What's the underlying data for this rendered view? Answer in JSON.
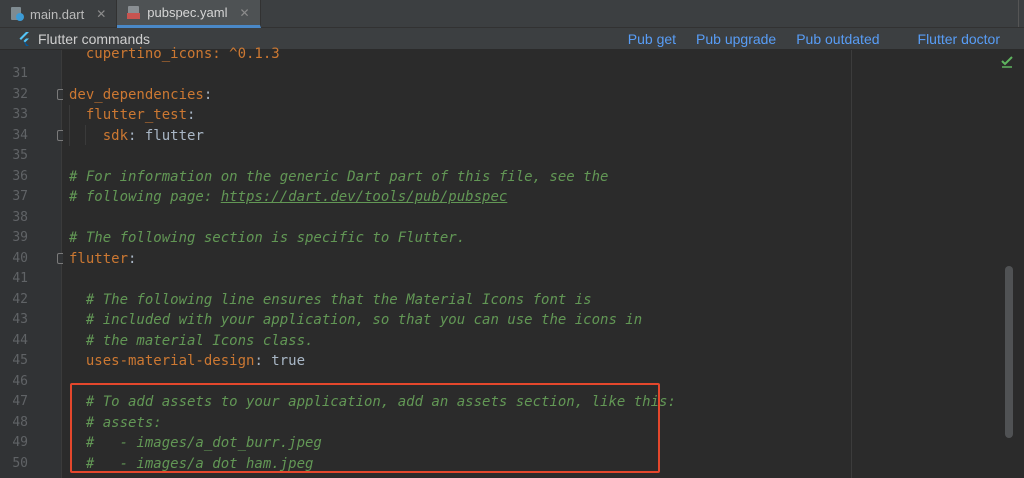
{
  "tabs": [
    {
      "label": "main.dart",
      "icon": "dart-file-icon",
      "active": false
    },
    {
      "label": "pubspec.yaml",
      "icon": "yaml-file-icon",
      "active": true
    }
  ],
  "flutter_bar": {
    "title": "Flutter commands",
    "actions": [
      "Pub get",
      "Pub upgrade",
      "Pub outdated",
      "Flutter doctor"
    ]
  },
  "editor": {
    "partial_top_line": "cupertino_icons: ^0.1.3",
    "line_numbers": [
      "31",
      "32",
      "33",
      "34",
      "35",
      "36",
      "37",
      "38",
      "39",
      "40",
      "41",
      "42",
      "43",
      "44",
      "45",
      "46",
      "47",
      "48",
      "49",
      "50"
    ],
    "line32": {
      "key": "dev_dependencies",
      "colon": ":"
    },
    "line33": {
      "key": "flutter_test",
      "colon": ":"
    },
    "line34": {
      "key": "sdk",
      "colon": ": ",
      "value": "flutter"
    },
    "line36": "# For information on the generic Dart part of this file, see the",
    "line37_prefix": "# following page: ",
    "line37_link": "https://dart.dev/tools/pub/pubspec",
    "line39": "# The following section is specific to Flutter.",
    "line40": {
      "key": "flutter",
      "colon": ":"
    },
    "line42": "# The following line ensures that the Material Icons font is",
    "line43": "# included with your application, so that you can use the icons in",
    "line44": "# the material Icons class.",
    "line45": {
      "key": "uses-material-design",
      "colon": ": ",
      "value": "true"
    },
    "line47": "# To add assets to your application, add an assets section, like this:",
    "line48": "# assets:",
    "line49": "#   - images/a_dot_burr.jpeg",
    "line50": "#   - images/a_dot_ham.jpeg"
  },
  "colors": {
    "highlight_border": "#e4472c",
    "link_blue": "#589df6",
    "yaml_key": "#cc7832",
    "comment_green": "#629755"
  }
}
